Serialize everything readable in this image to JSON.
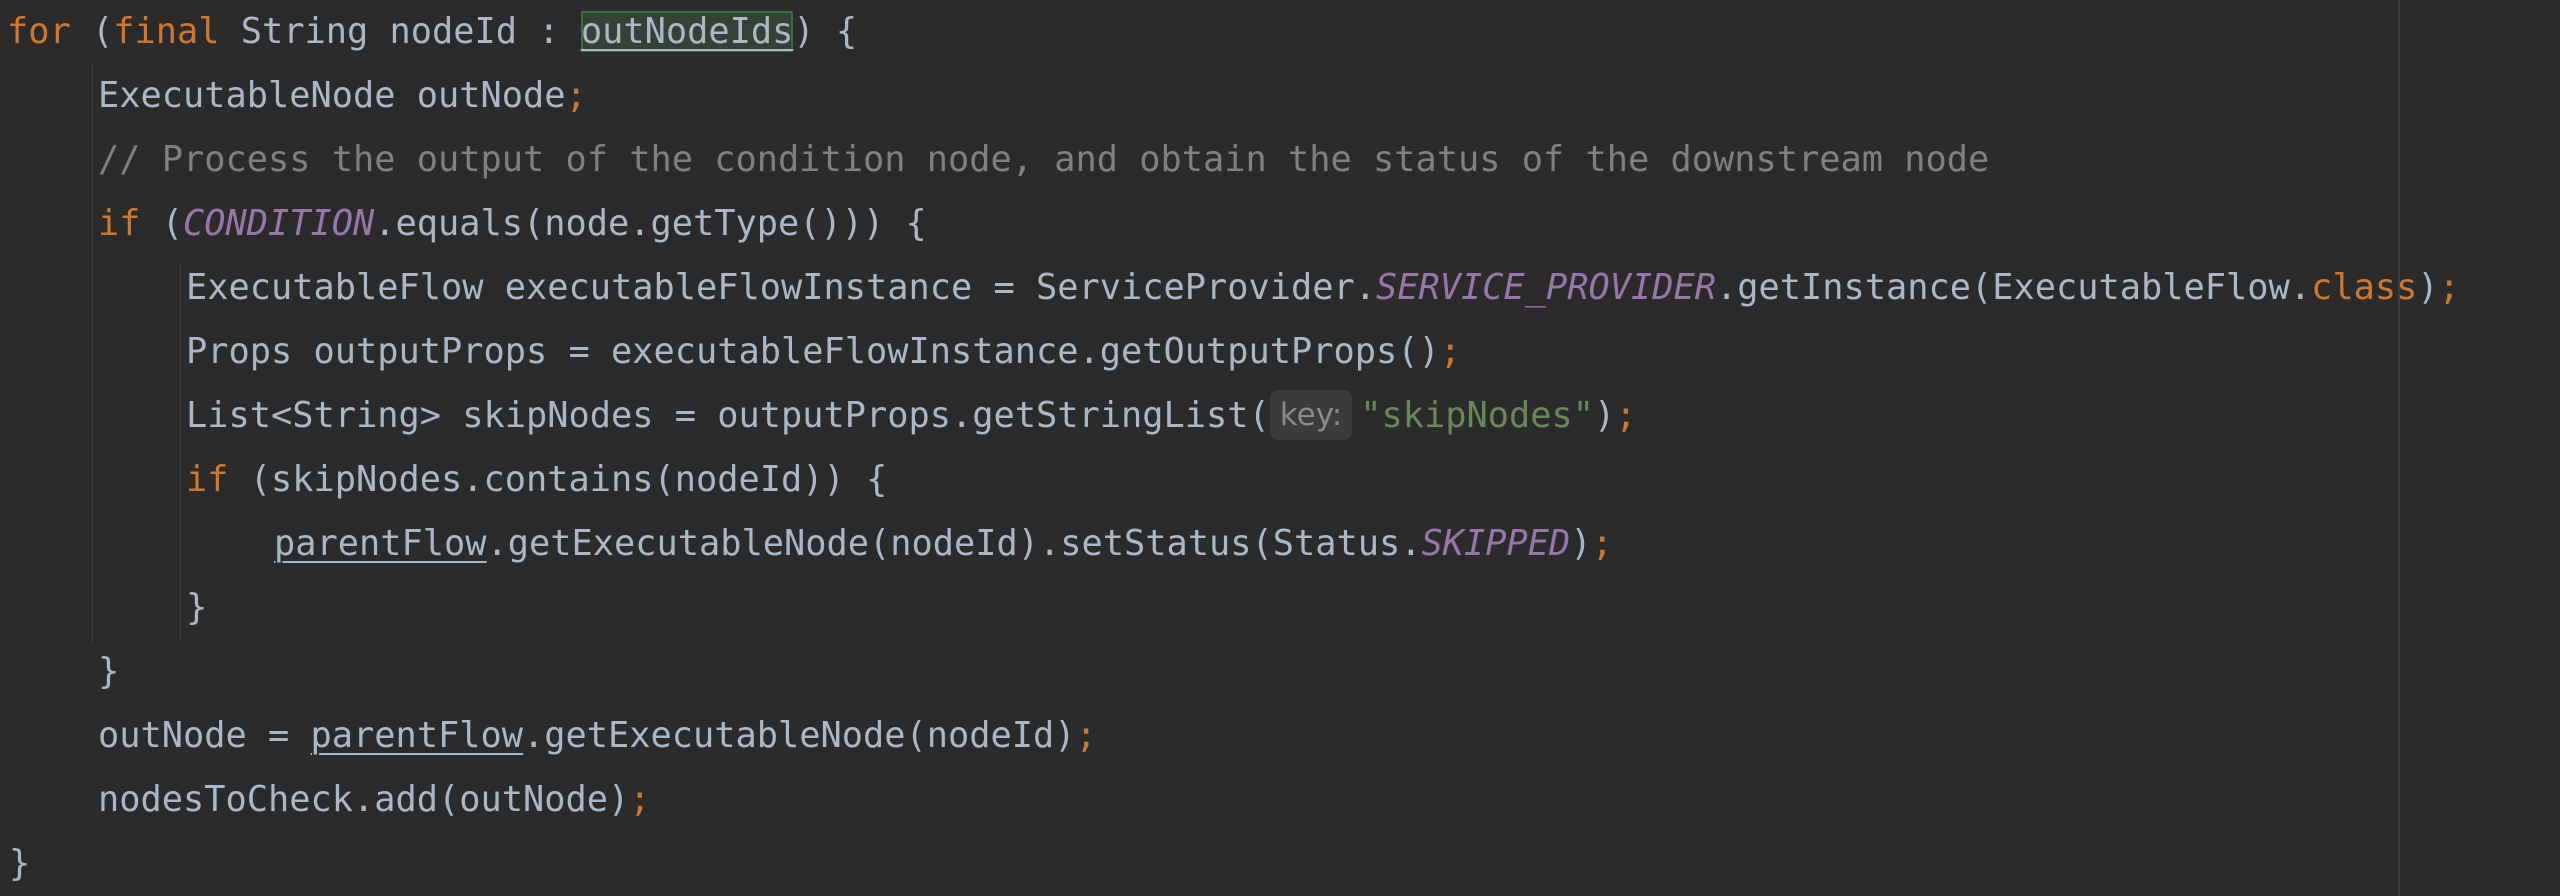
{
  "editor": {
    "language": "java",
    "colors": {
      "background": "#2b2b2b",
      "keyword": "#cc7832",
      "plain": "#a9b7c6",
      "comment": "#808080",
      "constant": "#9876aa",
      "string": "#6a8759",
      "usage_highlight": "#344134"
    },
    "lines": {
      "l1": {
        "kw_for": "for",
        "t1": " (",
        "kw_final": "final",
        "t2": " String nodeId : ",
        "var_out": "outNodeIds",
        "t3": ") {"
      },
      "l2": {
        "t1": "ExecutableNode outNode",
        "semi": ";"
      },
      "l3": {
        "comment": "// Process the output of the condition node, and obtain the status of the downstream node"
      },
      "l4": {
        "kw_if": "if",
        "t1": " (",
        "const": "CONDITION",
        "t2": ".equals(node.getType())) {"
      },
      "l5": {
        "t1": "ExecutableFlow executableFlowInstance = ServiceProvider.",
        "const": "SERVICE_PROVIDER",
        "t2": ".getInstance(ExecutableFlow.",
        "kw_class": "class",
        "t3": ")",
        "semi": ";"
      },
      "l6": {
        "t1": "Props outputProps = executableFlowInstance.getOutputProps()",
        "semi": ";"
      },
      "l7": {
        "t1": "List<String> skipNodes = outputProps.getStringList(",
        "hint": "key:",
        "str": "\"skipNodes\"",
        "t2": ")",
        "semi": ";"
      },
      "l8": {
        "kw_if": "if",
        "t1": " (skipNodes.contains(nodeId)) {"
      },
      "l9": {
        "field": "parentFlow",
        "t1": ".getExecutableNode(nodeId).setStatus(Status.",
        "const": "SKIPPED",
        "t2": ")",
        "semi": ";"
      },
      "l10": {
        "t1": "}"
      },
      "l11": {
        "t1": "}"
      },
      "l12": {
        "t1": "outNode = ",
        "field": "parentFlow",
        "t2": ".getExecutableNode(nodeId)",
        "semi": ";"
      },
      "l13": {
        "t1": "nodesToCheck.add(outNode)",
        "semi": ";"
      },
      "l14": {
        "t1": "}"
      }
    }
  }
}
